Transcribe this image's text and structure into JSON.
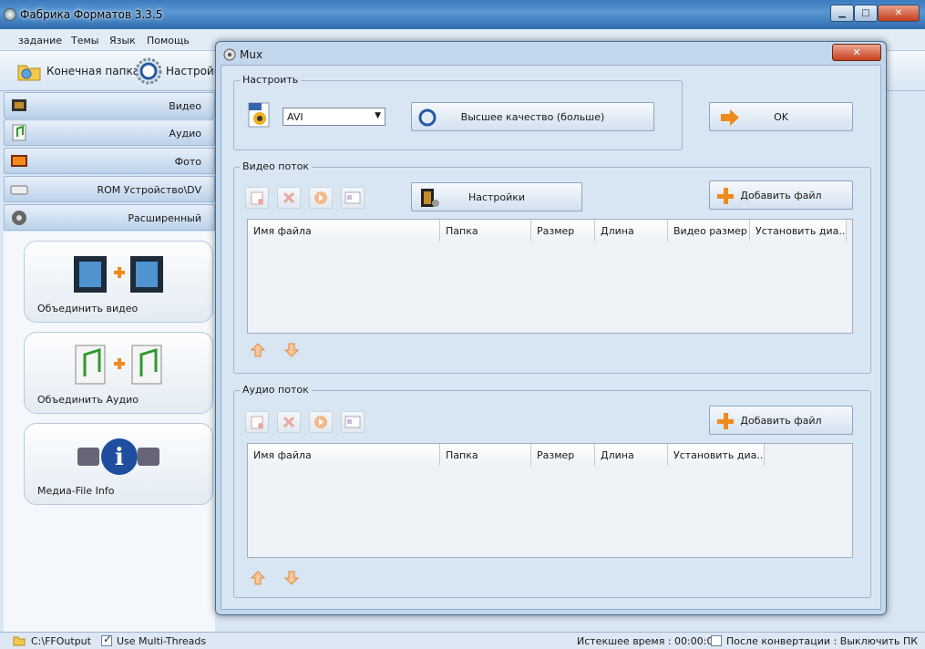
{
  "main": {
    "title": "Фабрика Форматов 3.3.5",
    "window_buttons": {
      "minimize": "▁",
      "maximize": "□",
      "close": "✕"
    },
    "menu": [
      "задание",
      "Темы",
      "Язык",
      "Помощь"
    ],
    "toolbar": {
      "output_folder": "Конечная папка",
      "settings": "Настройк"
    },
    "categories": [
      {
        "label": "Видео",
        "icon": "video-icon"
      },
      {
        "label": "Аудио",
        "icon": "audio-icon"
      },
      {
        "label": "Фото",
        "icon": "photo-icon"
      },
      {
        "label": "ROM Устройство\\DV",
        "icon": "rom-icon"
      },
      {
        "label": "Расширенный",
        "icon": "advanced-icon"
      }
    ],
    "tools": [
      {
        "label": "Объединить видео",
        "icon": "join-video-icon"
      },
      {
        "label": "Объединить Аудио",
        "icon": "join-audio-icon"
      },
      {
        "label": "Медиа-File Info",
        "icon": "media-info-icon"
      }
    ]
  },
  "status": {
    "path": "C:\\FFOutput",
    "multithreads": "Use Multi-Threads",
    "elapsed": "Истекшее время : 00:00:00",
    "after": "После конвертации : Выключить ПК"
  },
  "dialog": {
    "title": "Mux",
    "close": "✕",
    "settings_group": "Настроить",
    "format_value": "AVI",
    "quality_button": "Высшее качество (больше)",
    "ok_button": "OK",
    "video_group": "Видео поток",
    "video_settings_button": "Настройки",
    "add_file_button": "Добавить файл",
    "video_columns": [
      "Имя файла",
      "Папка",
      "Размер",
      "Длина",
      "Видео размер",
      "Установить диа..."
    ],
    "audio_group": "Аудио поток",
    "audio_columns": [
      "Имя файла",
      "Папка",
      "Размер",
      "Длина",
      "Установить диа..."
    ]
  },
  "colors": {
    "accent": "#2a6aa8",
    "dialog_bg": "#d8e5f2",
    "close_red": "#c6401f",
    "orange": "#f08a1c"
  }
}
